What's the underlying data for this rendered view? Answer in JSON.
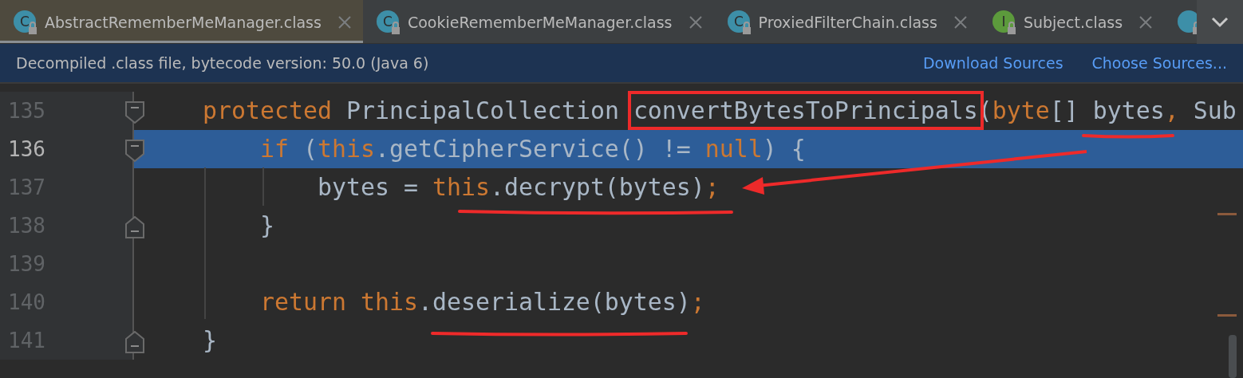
{
  "tabs": [
    {
      "kind": "class",
      "icon_letter": "C",
      "label": "AbstractRememberMeManager.class",
      "selected": true
    },
    {
      "kind": "class",
      "icon_letter": "C",
      "label": "CookieRememberMeManager.class",
      "selected": false
    },
    {
      "kind": "class",
      "icon_letter": "C",
      "label": "ProxiedFilterChain.class",
      "selected": false
    },
    {
      "kind": "interface",
      "icon_letter": "I",
      "label": "Subject.class",
      "selected": false
    },
    {
      "kind": "class",
      "selected": false
    }
  ],
  "banner": {
    "message": "Decompiled .class file, bytecode version: 50.0 (Java 6)",
    "links": [
      "Download Sources",
      "Choose Sources..."
    ]
  },
  "lines": [
    {
      "number": "135",
      "current": false,
      "fold_start": true,
      "fold_end": false,
      "tokens": [
        {
          "t": "    protected ",
          "kind": "keyword"
        },
        {
          "t": "PrincipalCollection ",
          "kind": "plain"
        },
        {
          "t": "convertBytesToPrincipals",
          "kind": "plain",
          "boxed": true
        },
        {
          "t": "(",
          "kind": "plain"
        },
        {
          "t": "byte",
          "kind": "keyword"
        },
        {
          "t": "[] bytes",
          "kind": "plain"
        },
        {
          "t": ", ",
          "kind": "keyword"
        },
        {
          "t": "Sub",
          "kind": "plain"
        }
      ]
    },
    {
      "number": "136",
      "current": true,
      "fold_start": true,
      "fold_end": false,
      "tokens": [
        {
          "t": "        if ",
          "kind": "keyword"
        },
        {
          "t": "(",
          "kind": "plain"
        },
        {
          "t": "this",
          "kind": "keyword"
        },
        {
          "t": ".getCipherService() != ",
          "kind": "plain"
        },
        {
          "t": "null",
          "kind": "keyword"
        },
        {
          "t": ") {",
          "kind": "plain"
        }
      ]
    },
    {
      "number": "137",
      "current": false,
      "fold_start": false,
      "fold_end": false,
      "tokens": [
        {
          "t": "            bytes = ",
          "kind": "plain"
        },
        {
          "t": "this",
          "kind": "keyword"
        },
        {
          "t": ".decrypt(bytes)",
          "kind": "plain"
        },
        {
          "t": ";",
          "kind": "keyword"
        }
      ]
    },
    {
      "number": "138",
      "current": false,
      "fold_start": false,
      "fold_end": true,
      "tokens": [
        {
          "t": "        }",
          "kind": "plain"
        }
      ]
    },
    {
      "number": "139",
      "current": false,
      "fold_start": false,
      "fold_end": false
    },
    {
      "number": "140",
      "current": false,
      "fold_start": false,
      "fold_end": false,
      "tokens": [
        {
          "t": "        return ",
          "kind": "keyword"
        },
        {
          "t": "this",
          "kind": "keyword"
        },
        {
          "t": ".deserialize(bytes)",
          "kind": "plain"
        },
        {
          "t": ";",
          "kind": "keyword"
        }
      ]
    },
    {
      "number": "141",
      "current": false,
      "fold_start": false,
      "fold_end": true,
      "tokens": [
        {
          "t": "    }",
          "kind": "plain"
        }
      ]
    }
  ]
}
